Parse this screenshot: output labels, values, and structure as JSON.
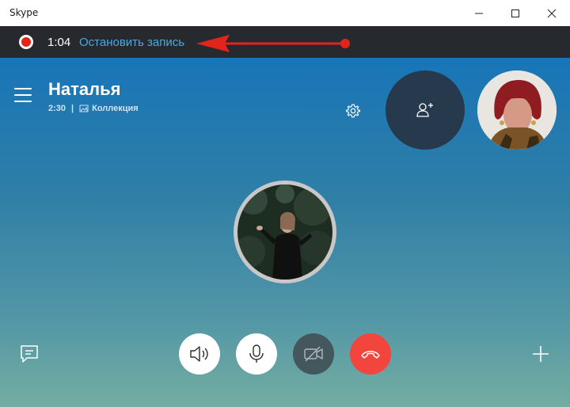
{
  "window": {
    "title": "Skype"
  },
  "recording": {
    "time": "1:04",
    "stop_label": "Остановить запись"
  },
  "contact": {
    "name": "Наталья",
    "duration": "2:30",
    "collection_label": "Коллекция"
  },
  "colors": {
    "record_red": "#e1251b",
    "link_blue": "#4aa8e0",
    "end_call_red": "#f1453d",
    "add_person_bg": "#27394d"
  },
  "icons": [
    "minimize-icon",
    "maximize-icon",
    "close-icon",
    "record-icon",
    "arrow-annotation",
    "hamburger-icon",
    "gallery-icon",
    "gear-icon",
    "add-person-icon",
    "chat-icon",
    "speaker-icon",
    "microphone-icon",
    "video-off-icon",
    "end-call-icon",
    "plus-icon"
  ]
}
